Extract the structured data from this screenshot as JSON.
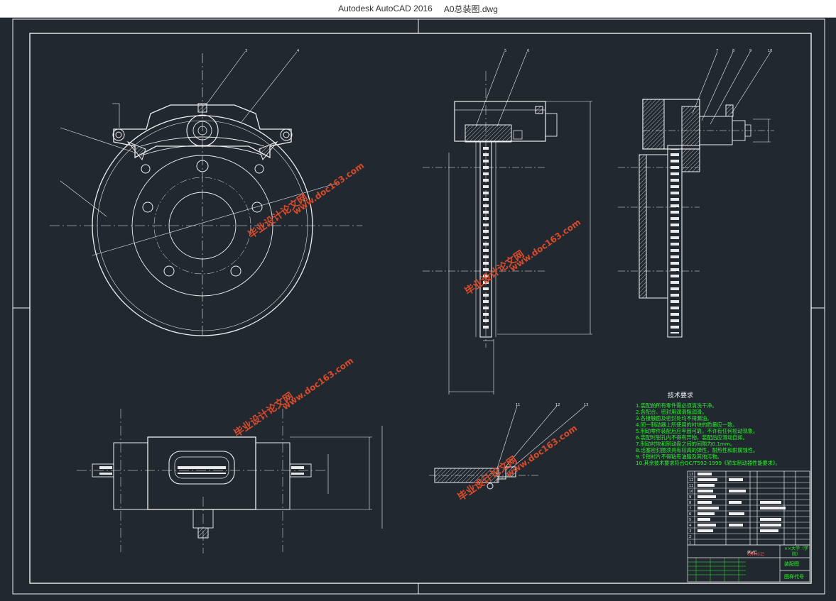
{
  "window": {
    "app_title": "Autodesk AutoCAD 2016",
    "file_name": "A0总装图.dwg"
  },
  "drawing": {
    "balloons": [
      "3",
      "4",
      "5",
      "6",
      "7",
      "8",
      "9",
      "10",
      "11",
      "12",
      "13"
    ],
    "tech_requirements_title": "技术要求",
    "tech_requirements": [
      "1.装配前所有零件需必须清洗干净。",
      "2.各配合、密封用润滑脂润滑。",
      "3.各接触面及密封处均不得漏油。",
      "4.同一制动器上所使用的衬块的质量应一致。",
      "5.制动零件装配后应牢固可靠，不许有任何松动现象。",
      "6.装配时钳孔内不得有异物，装配后应滑动自如。",
      "7.制动衬块和制动盘之间的间隙为0.1mm。",
      "8.活塞密封圈须具有较高的弹性，耐热性和耐腐蚀性。",
      "9.卡钳衬片不得粘有油脂及其他污物。",
      "10.其余技术要求符合QC/T592-1999《轿车制动器性能要求》。"
    ],
    "watermark": "毕业设计论文网",
    "watermark_url": "www.doc163.com",
    "title_block": {
      "material_label": "材料标记",
      "drawing_name": "装配图",
      "drawing_code": "图样代号",
      "org": "××大学（学院）",
      "pvc": "PVC"
    },
    "colors": {
      "background": "#212830",
      "line": "#f0f0f0",
      "center_line": "#f0f0f0",
      "text_green": "#2cf32c",
      "watermark": "#d94b2a"
    }
  }
}
